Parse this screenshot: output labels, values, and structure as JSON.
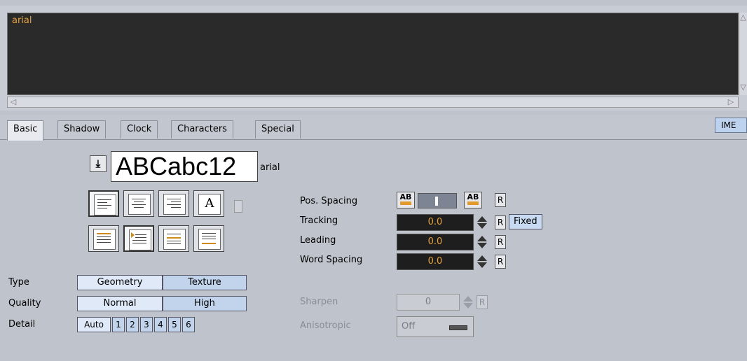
{
  "editor": {
    "text": "arial"
  },
  "tabs": [
    "Basic",
    "Shadow",
    "Clock",
    "Characters",
    "Special"
  ],
  "ime_label": "IME",
  "preview": {
    "sample": "ABCabc12",
    "font_name": "arial"
  },
  "spacing": {
    "pos_spacing_label": "Pos. Spacing",
    "ab_label": "AB",
    "reset_label": "R",
    "tracking": {
      "label": "Tracking",
      "value": "0.0",
      "mode": "Fixed"
    },
    "leading": {
      "label": "Leading",
      "value": "0.0"
    },
    "word_spacing": {
      "label": "Word Spacing",
      "value": "0.0"
    }
  },
  "type": {
    "label": "Type",
    "options": [
      "Geometry",
      "Texture"
    ],
    "selected": "Geometry"
  },
  "quality": {
    "label": "Quality",
    "options": [
      "Normal",
      "High"
    ],
    "selected": "Normal"
  },
  "detail": {
    "label": "Detail",
    "options": [
      "Auto",
      "1",
      "2",
      "3",
      "4",
      "5",
      "6"
    ],
    "selected": "Auto"
  },
  "sharpen": {
    "label": "Sharpen",
    "value": "0",
    "reset_label": "R"
  },
  "anisotropic": {
    "label": "Anisotropic",
    "value": "Off"
  },
  "colors": {
    "value_text": "#e8a33c",
    "field_bg": "#1e1e1e",
    "tab_active": "#e8eaf0",
    "toggle_selected": "#dfe9f7"
  }
}
